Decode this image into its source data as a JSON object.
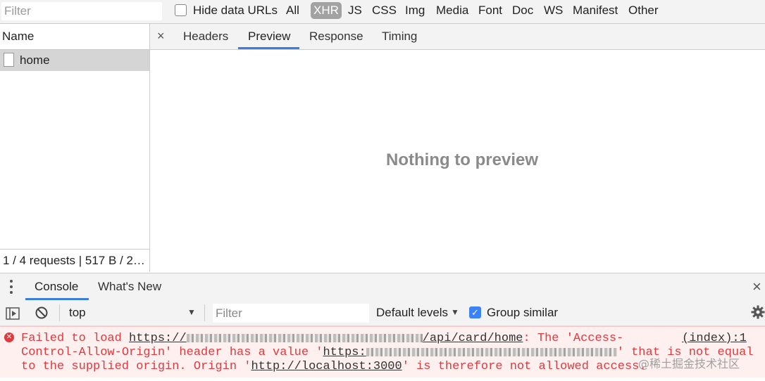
{
  "filterbar": {
    "filter_placeholder": "Filter",
    "hide_data_urls_label": "Hide data URLs",
    "types": [
      "All",
      "XHR",
      "JS",
      "CSS",
      "Img",
      "Media",
      "Font",
      "Doc",
      "WS",
      "Manifest",
      "Other"
    ],
    "selected_type": "XHR"
  },
  "requests": {
    "column_header": "Name",
    "rows": [
      {
        "name": "home"
      }
    ],
    "status": "1 / 4 requests | 517 B / 2…"
  },
  "detail": {
    "close_label": "×",
    "tabs": [
      "Headers",
      "Preview",
      "Response",
      "Timing"
    ],
    "active_tab": "Preview",
    "empty_message": "Nothing to preview"
  },
  "drawer": {
    "menu_icon": "kebab-menu-icon",
    "tabs": [
      "Console",
      "What's New"
    ],
    "active_tab": "Console",
    "close_label": "×"
  },
  "console_toolbar": {
    "context": "top",
    "filter_placeholder": "Filter",
    "levels": "Default levels",
    "group_similar_label": "Group similar",
    "group_similar_checked": true
  },
  "error": {
    "line1_prefix": "Failed to load ",
    "line1_url_start": "https://",
    "line1_url_end": "/api/card/home",
    "line1_suffix": ": The 'Access-",
    "line2_prefix": "Control-Allow-Origin' header has a value '",
    "line2_url_start": "https:",
    "line2_suffix": "' that is not equal",
    "line3_prefix": "to the supplied origin. Origin '",
    "line3_url": "http://localhost:3000",
    "line3_suffix": "' is therefore not allowed access.",
    "source": "(index):1"
  },
  "watermark": "@稀土掘金技术社区",
  "colors": {
    "accent": "#3a7fe0",
    "error_text": "#e0393e",
    "error_bg": "#fff0f0",
    "selected_type_bg": "#a2a2a2"
  }
}
